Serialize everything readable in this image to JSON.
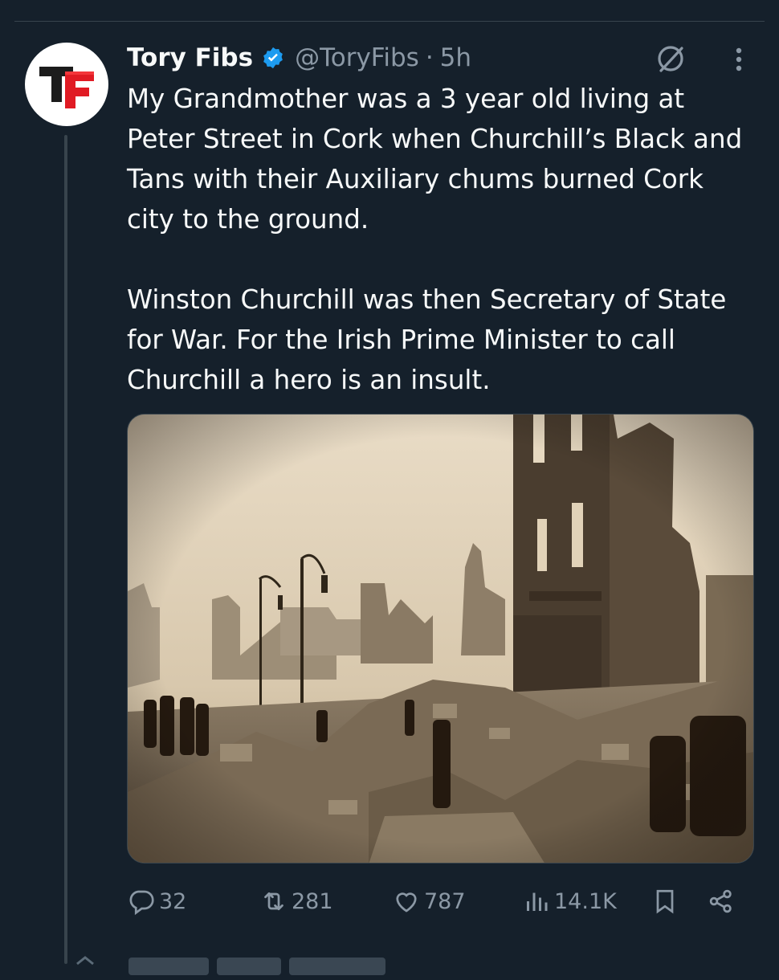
{
  "tweet": {
    "author_name": "Tory Fibs",
    "handle": "@ToryFibs",
    "separator": "·",
    "time": "5h",
    "avatar_text": "TF",
    "paragraph_1": "My Grandmother was a 3 year old living at Peter Street in Cork when Churchill’s Black and Tans with their Auxiliary chums burned Cork city to the ground.",
    "paragraph_2": "Winston Churchill was then Secretary of State for War. For the Irish Prime Minister to call Churchill a hero is an insult."
  },
  "actions": {
    "replies": "32",
    "reposts": "281",
    "likes": "787",
    "views": "14.1K"
  },
  "icons": {
    "verified": "verified-badge-icon",
    "grok": "grok-icon",
    "more": "more-icon",
    "reply": "reply-icon",
    "repost": "repost-icon",
    "like": "heart-icon",
    "views": "views-icon",
    "bookmark": "bookmark-icon",
    "share": "share-icon"
  },
  "colors": {
    "background": "#15202b",
    "text": "#f7f9f9",
    "muted": "#8b98a5",
    "verified": "#1d9bf0",
    "brand_red": "#e01b24"
  }
}
